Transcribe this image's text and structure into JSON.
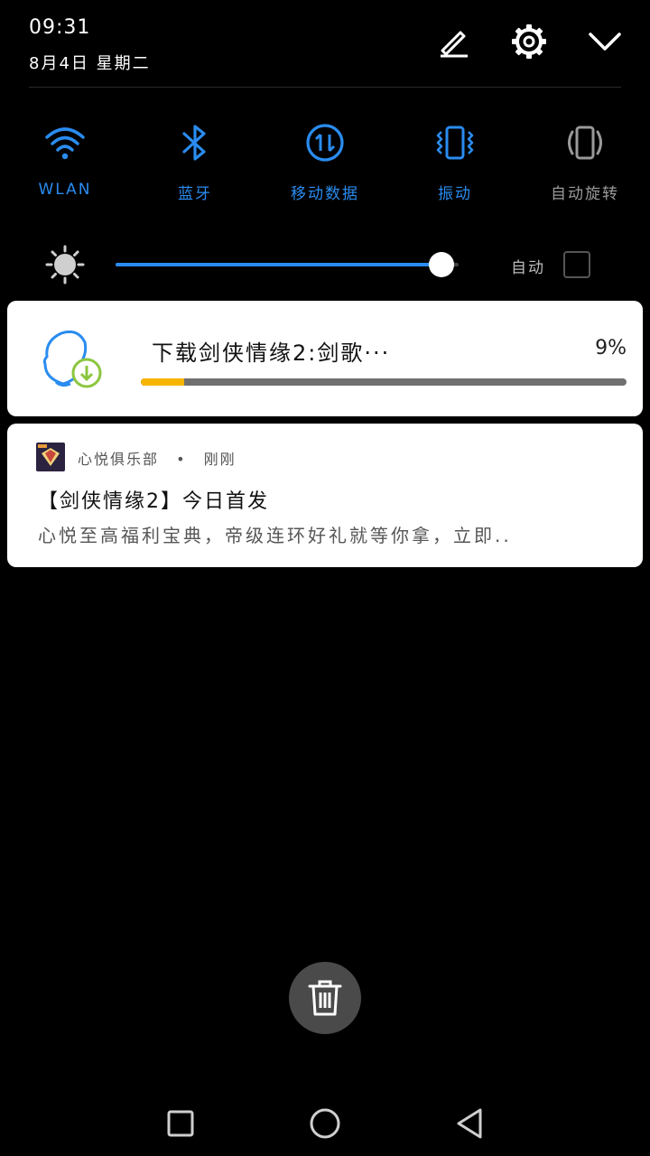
{
  "status": {
    "time": "09:31",
    "date": "8月4日 星期二"
  },
  "header_icons": [
    "edit-icon",
    "settings-gear-icon",
    "collapse-chevron-icon"
  ],
  "toggles": [
    {
      "label": "WLAN",
      "icon": "wifi-icon",
      "state": "on"
    },
    {
      "label": "蓝牙",
      "icon": "bluetooth-icon",
      "state": "on"
    },
    {
      "label": "移动数据",
      "icon": "mobile-data-icon",
      "state": "on"
    },
    {
      "label": "振动",
      "icon": "vibrate-icon",
      "state": "on"
    },
    {
      "label": "自动旋转",
      "icon": "auto-rotate-icon",
      "state": "off"
    }
  ],
  "brightness": {
    "level": 0.95,
    "auto_label": "自动",
    "auto_checked": false
  },
  "download_notification": {
    "title": "下载剑侠情缘2:剑歌···",
    "percent_text": "9%",
    "progress": 0.09,
    "icon": "app-download-icon"
  },
  "message_notification": {
    "app_name": "心悦俱乐部",
    "separator": "•",
    "time": "刚刚",
    "title": "【剑侠情缘2】今日首发",
    "body": "心悦至高福利宝典，帝级连环好礼就等你拿，立即.."
  },
  "clear_button": {
    "icon": "trash-icon"
  },
  "navigation": [
    "recent-apps-icon",
    "home-icon",
    "back-icon"
  ],
  "colors": {
    "accent": "#2a8cf0",
    "progress": "#f7b500",
    "background": "#000000"
  }
}
